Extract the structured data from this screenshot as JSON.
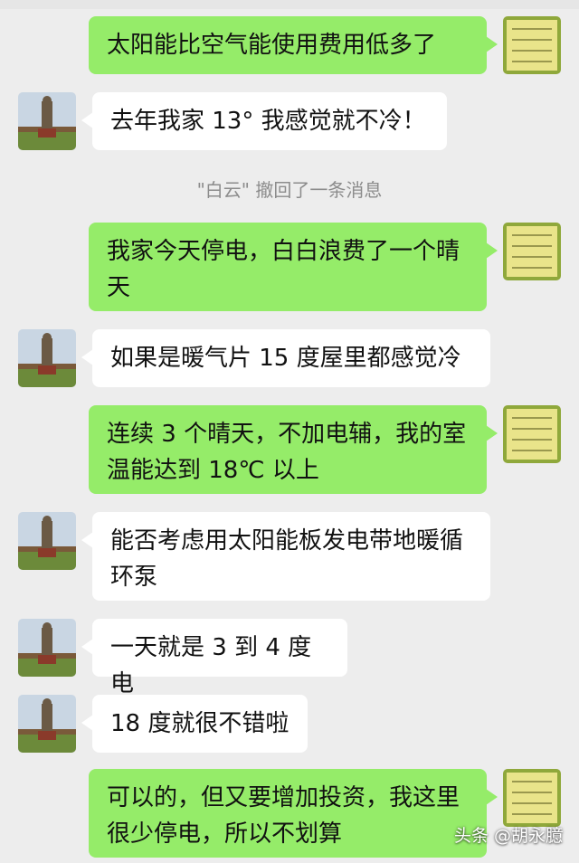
{
  "colors": {
    "me_bubble": "#95ec69",
    "other_bubble": "#ffffff",
    "background": "#ededed"
  },
  "messages": [
    {
      "from": "me",
      "text": "太阳能比空气能使用费用低多了"
    },
    {
      "from": "other",
      "text": "去年我家 13° 我感觉就不冷！"
    },
    {
      "type": "system",
      "text": "\"白云\" 撤回了一条消息"
    },
    {
      "from": "me",
      "text": "我家今天停电，白白浪费了一个晴天"
    },
    {
      "from": "other",
      "text": "如果是暖气片 15 度屋里都感觉冷"
    },
    {
      "from": "me",
      "text": "连续 3 个晴天，不加电辅，我的室温能达到 18℃ 以上"
    },
    {
      "from": "other",
      "text": "能否考虑用太阳能板发电带地暖循环泵"
    },
    {
      "from": "other",
      "text": "一天就是 3 到 4 度电"
    },
    {
      "from": "other",
      "text": "18 度就很不错啦"
    },
    {
      "from": "me",
      "text": "可以的，但又要增加投资，我这里很少停电，所以不划算"
    }
  ],
  "my_avatar": {
    "icon": "calligraphy-avatar-icon",
    "text": "闻无信不兴 人无信不立 市无信不旺 商无信不发"
  },
  "other_avatar": {
    "icon": "statue-avatar-icon"
  },
  "watermark": "头条 @胡永臆"
}
